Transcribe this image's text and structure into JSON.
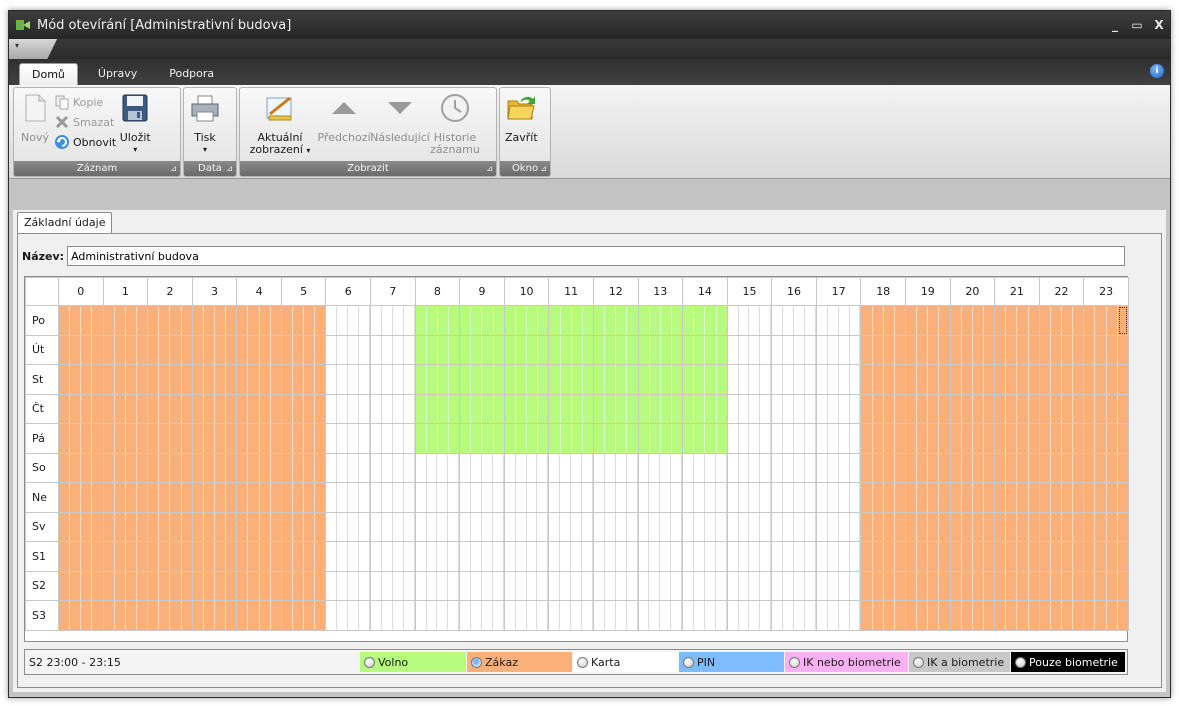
{
  "window": {
    "title": "Mód otevírání [Administrativní budova]",
    "controls": [
      "_",
      "▭",
      "X"
    ]
  },
  "ribbon_tabs": [
    "Domů",
    "Úpravy",
    "Podpora"
  ],
  "ribbon": {
    "zaznam": {
      "label": "Záznam",
      "novy": "Nový",
      "kopie": "Kopie",
      "smazat": "Smazat",
      "obnovit": "Obnovit",
      "ulozit": "Uložit"
    },
    "data": {
      "label": "Data",
      "tisk": "Tisk"
    },
    "zobrazit": {
      "label": "Zobrazit",
      "aktualni_1": "Aktuální",
      "aktualni_2": "zobrazení",
      "predchozi": "Předchozí",
      "nasledujici": "Následující",
      "historie_1": "Historie",
      "historie_2": "záznamu"
    },
    "okno": {
      "label": "Okno",
      "zavrit": "Zavřít"
    }
  },
  "content_tab": "Základní údaje",
  "name_field": {
    "label": "Název:",
    "value": "Administrativní budova"
  },
  "schedule": {
    "hours": [
      "0",
      "1",
      "2",
      "3",
      "4",
      "5",
      "6",
      "7",
      "8",
      "9",
      "10",
      "11",
      "12",
      "13",
      "14",
      "15",
      "16",
      "17",
      "18",
      "19",
      "20",
      "21",
      "22",
      "23"
    ],
    "rows": [
      "Po",
      "Út",
      "St",
      "Čt",
      "Pá",
      "So",
      "Ne",
      "Sv",
      "S1",
      "S2",
      "S3"
    ],
    "slots_per_hour": 4,
    "zakaz_before_hour": 6,
    "zakaz_from_hour": 18,
    "volno_days": [
      "Po",
      "Út",
      "St",
      "Čt",
      "Pá"
    ],
    "volno_from_hour": 8,
    "volno_to_hour": 15
  },
  "status": {
    "text": "S2 23:00 - 23:15"
  },
  "legend": [
    {
      "label": "Volno",
      "color": "#b6fb7e",
      "checked": false
    },
    {
      "label": "Zákaz",
      "color": "#fbb07a",
      "checked": true
    },
    {
      "label": "Karta",
      "color": "#ffffff",
      "checked": false
    },
    {
      "label": "PIN",
      "color": "#7fbcff",
      "checked": false
    },
    {
      "label": "IK nebo biometrie",
      "color": "#fbb0f4",
      "checked": false
    },
    {
      "label": "IK a biometrie",
      "color": "#c8c8c8",
      "checked": false
    },
    {
      "label": "Pouze biometrie",
      "color": "#000000",
      "checked": false
    }
  ]
}
